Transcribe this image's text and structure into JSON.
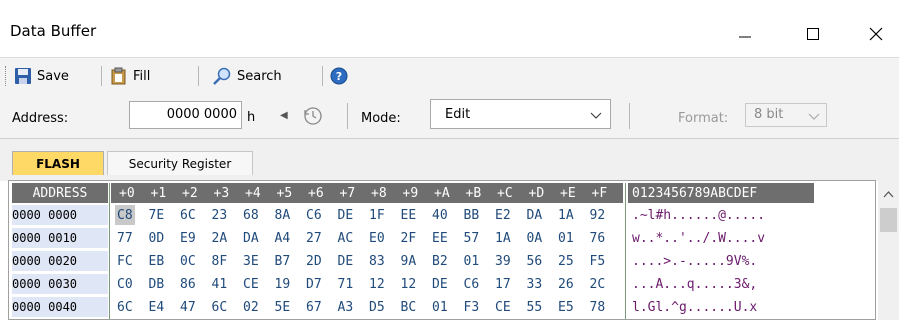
{
  "window": {
    "title": "Data Buffer"
  },
  "toolbar": {
    "save": "Save",
    "fill": "Fill",
    "search": "Search"
  },
  "addrbar": {
    "address_label": "Address:",
    "address_value": "0000 0000",
    "address_suffix": "h",
    "mode_label": "Mode:",
    "mode_value": "Edit",
    "format_label": "Format:",
    "format_value": "8 bit"
  },
  "tabs": [
    "FLASH",
    "Security Register"
  ],
  "grid": {
    "header_address": "ADDRESS",
    "header_cols": [
      "+0",
      "+1",
      "+2",
      "+3",
      "+4",
      "+5",
      "+6",
      "+7",
      "+8",
      "+9",
      "+A",
      "+B",
      "+C",
      "+D",
      "+E",
      "+F"
    ],
    "header_ascii": "0123456789ABCDEF",
    "rows": [
      {
        "addr": "0000 0000",
        "bytes": [
          "C8",
          "7E",
          "6C",
          "23",
          "68",
          "8A",
          "C6",
          "DE",
          "1F",
          "EE",
          "40",
          "BB",
          "E2",
          "DA",
          "1A",
          "92"
        ],
        "ascii": ".~l#h......@....."
      },
      {
        "addr": "0000 0010",
        "bytes": [
          "77",
          "0D",
          "E9",
          "2A",
          "DA",
          "A4",
          "27",
          "AC",
          "E0",
          "2F",
          "EE",
          "57",
          "1A",
          "0A",
          "01",
          "76"
        ],
        "ascii": "w..*..'../.W....v"
      },
      {
        "addr": "0000 0020",
        "bytes": [
          "FC",
          "EB",
          "0C",
          "8F",
          "3E",
          "B7",
          "2D",
          "DE",
          "83",
          "9A",
          "B2",
          "01",
          "39",
          "56",
          "25",
          "F5"
        ],
        "ascii": "....>.-.....9V%."
      },
      {
        "addr": "0000 0030",
        "bytes": [
          "C0",
          "DB",
          "86",
          "41",
          "CE",
          "19",
          "D7",
          "71",
          "12",
          "12",
          "DE",
          "C6",
          "17",
          "33",
          "26",
          "2C"
        ],
        "ascii": "...A...q.....3&,"
      },
      {
        "addr": "0000 0040",
        "bytes": [
          "6C",
          "E4",
          "47",
          "6C",
          "02",
          "5E",
          "67",
          "A3",
          "D5",
          "BC",
          "01",
          "F3",
          "CE",
          "55",
          "E5",
          "78"
        ],
        "ascii": "l.Gl.^g......U.x"
      }
    ]
  },
  "colors": {
    "header_bg": "#6e6e6e",
    "tab_active": "#ffd966",
    "addr_bg": "#dfe6f5",
    "hex_text": "#1f4a7a",
    "ascii_text": "#6a1a6a",
    "selection": "#c9c9c9"
  }
}
